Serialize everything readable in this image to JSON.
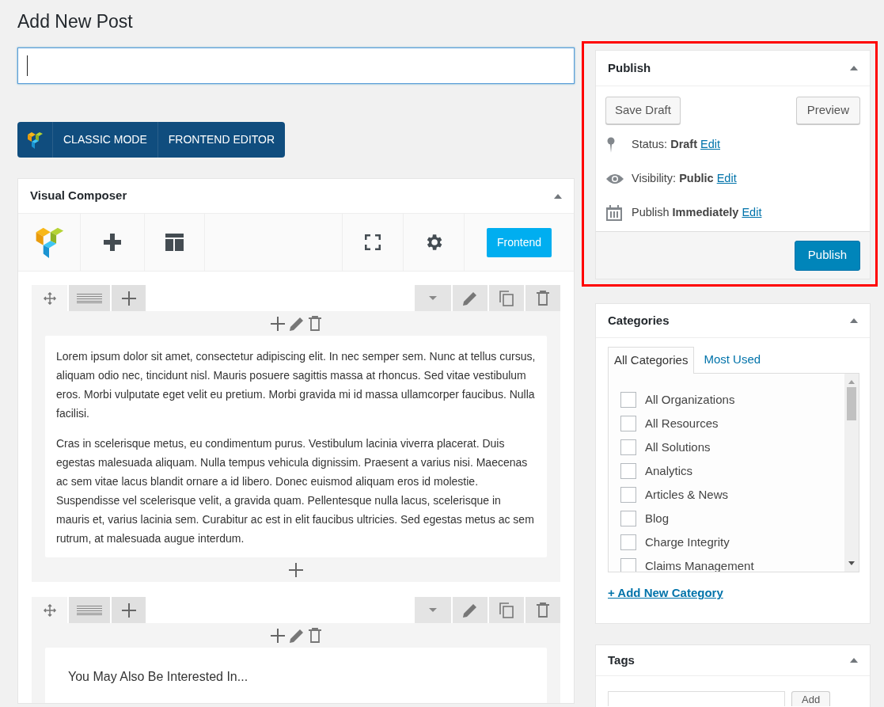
{
  "page_title": "Add New Post",
  "title_field": {
    "focused": true
  },
  "editor_mode_buttons": [
    "CLASSIC MODE",
    "FRONTEND EDITOR"
  ],
  "visual_composer": {
    "title": "Visual Composer",
    "frontend_button": "Frontend",
    "rows": [
      {
        "kind": "text",
        "paragraphs": [
          "Lorem ipsum dolor sit amet, consectetur adipiscing elit. In nec semper sem. Nunc at tellus cursus, aliquam odio nec, tincidunt nisl. Mauris posuere sagittis massa at rhoncus. Sed vitae vestibulum eros. Morbi vulputate eget velit eu pretium. Morbi gravida mi id massa ullamcorper faucibus. Nulla facilisi.",
          "Cras in scelerisque metus, eu condimentum purus. Vestibulum lacinia viverra placerat. Duis egestas malesuada aliquam. Nulla tempus vehicula dignissim. Praesent a varius nisi. Maecenas ac sem vitae lacus blandit ornare a id libero. Donec euismod aliquam eros id molestie. Suspendisse vel scelerisque velit, a gravida quam. Pellentesque nulla lacus, scelerisque in mauris et, varius lacinia sem. Curabitur ac est in elit faucibus ultricies. Sed egestas metus ac sem rutrum, at malesuada augue interdum."
        ]
      },
      {
        "kind": "heading",
        "heading": "You May Also Be Interested In..."
      }
    ]
  },
  "publish": {
    "title": "Publish",
    "highlighted": true,
    "save_draft": "Save Draft",
    "preview": "Preview",
    "rows": [
      {
        "kind": "status",
        "text": "Status: **Draft**",
        "link": "Edit"
      },
      {
        "kind": "visibility",
        "text": "Visibility: **Public**",
        "link": "Edit"
      },
      {
        "kind": "schedule",
        "text": "Publish **Immediately**",
        "link": "Edit"
      }
    ],
    "publish_button": "Publish"
  },
  "categories": {
    "title": "Categories",
    "tabs": [
      {
        "label": "All Categories",
        "selected": true
      },
      {
        "label": "Most Used",
        "selected": false
      }
    ],
    "items": [
      {
        "label": "All Organizations",
        "checked": false
      },
      {
        "label": "All Resources",
        "checked": false
      },
      {
        "label": "All Solutions",
        "checked": false
      },
      {
        "label": "Analytics",
        "checked": false
      },
      {
        "label": "Articles & News",
        "checked": false
      },
      {
        "label": "Blog",
        "checked": false
      },
      {
        "label": "Charge Integrity",
        "checked": false
      },
      {
        "label": "Claims Management",
        "checked": false
      }
    ],
    "add_link": "+ Add New Category"
  },
  "tags": {
    "title": "Tags",
    "add_button": "Add"
  }
}
